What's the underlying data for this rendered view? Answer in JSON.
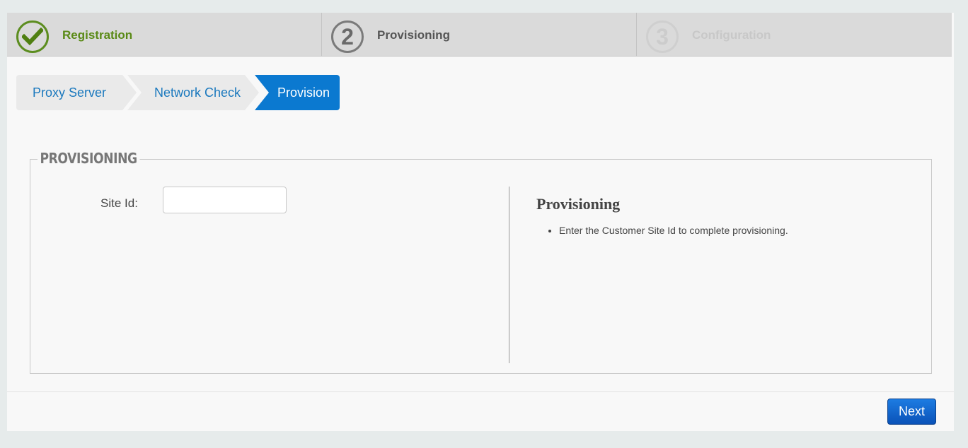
{
  "steps": [
    {
      "number": "",
      "label": "Registration",
      "state": "complete",
      "icon": "check-icon"
    },
    {
      "number": "2",
      "label": "Provisioning",
      "state": "current"
    },
    {
      "number": "3",
      "label": "Configuration",
      "state": "disabled"
    }
  ],
  "subnav": [
    {
      "label": "Proxy Server"
    },
    {
      "label": "Network Check"
    },
    {
      "label": "Provision"
    }
  ],
  "panel": {
    "legend": "PROVISIONING",
    "site_id_label": "Site Id:",
    "site_id_value": "",
    "help_title": "Provisioning",
    "help_items": [
      "Enter the Customer Site Id to complete provisioning."
    ]
  },
  "footer": {
    "next_label": "Next"
  },
  "colors": {
    "accent_blue": "#0b79d0",
    "complete_green": "#5a8a16",
    "link_blue": "#1b79be"
  }
}
